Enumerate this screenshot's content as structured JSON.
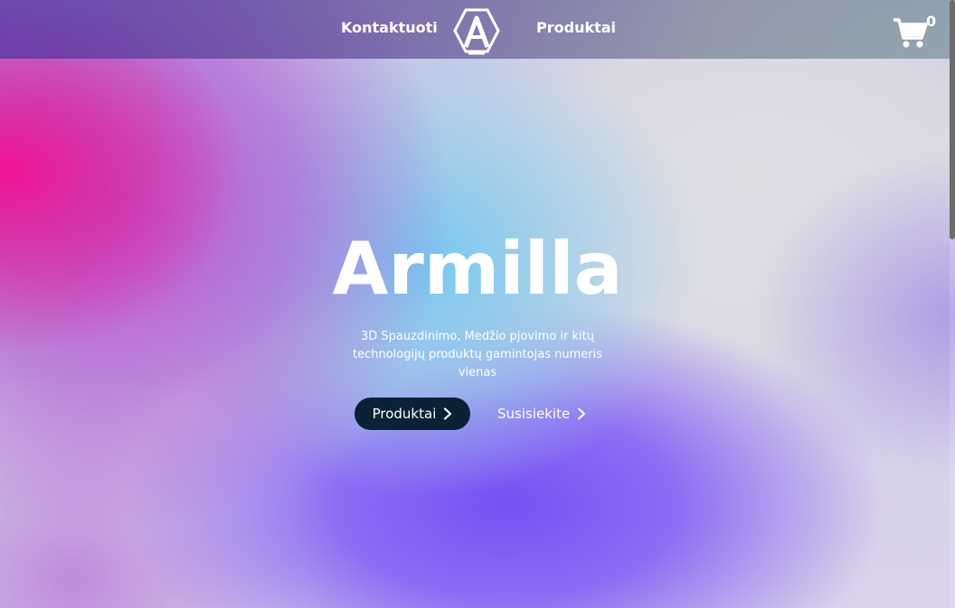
{
  "nav": {
    "contact_label": "Kontaktuoti",
    "products_label": "Produktai",
    "logo_icon": "hexagon-a-logo-icon",
    "cart_icon": "shopping-cart-icon",
    "cart_count": "0"
  },
  "hero": {
    "title": "Armilla",
    "subtitle": "3D Spauzdinimo, Medžio pjovimo ir kitų technologijų produktų gamintojas numeris vienas",
    "primary_button_label": "Produktai",
    "secondary_button_label": "Susisiekite",
    "chevron_icon": "chevron-right-icon"
  },
  "colors": {
    "primary_button_bg": "#0b2236",
    "text": "#ffffff"
  }
}
